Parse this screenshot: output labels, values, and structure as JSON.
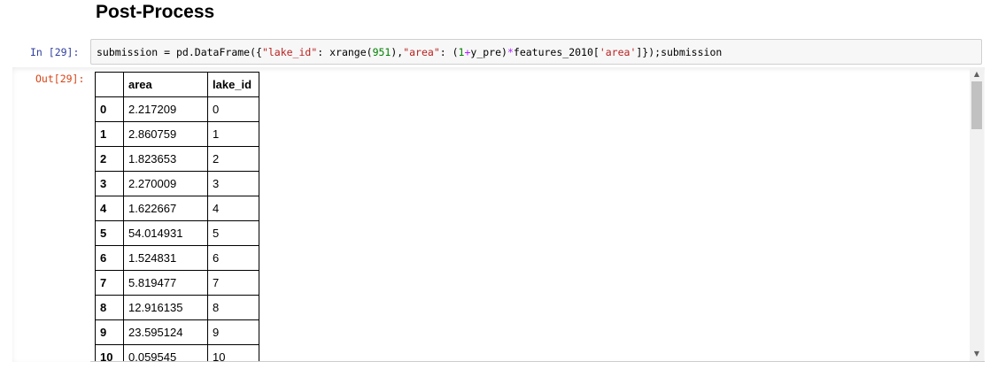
{
  "heading": "Post-Process",
  "input_cell": {
    "prompt": "In  [29]:",
    "code": {
      "p1": "submission = pd.DataFrame({",
      "s1": "\"lake_id\"",
      "p2": ": xrange(",
      "n1": "951",
      "p3": "),",
      "s2": "\"area\"",
      "p4": ": (",
      "n2": "1",
      "o1": "+",
      "p5": "y_pre)",
      "o2": "*",
      "p6": "features_2010[",
      "s3": "'area'",
      "p7": "]});submission"
    }
  },
  "output_cell": {
    "prompt": "Out[29]:",
    "columns": [
      "",
      "area",
      "lake_id"
    ],
    "rows": [
      {
        "index": "0",
        "area": "2.217209",
        "lake_id": "0"
      },
      {
        "index": "1",
        "area": "2.860759",
        "lake_id": "1"
      },
      {
        "index": "2",
        "area": "1.823653",
        "lake_id": "2"
      },
      {
        "index": "3",
        "area": "2.270009",
        "lake_id": "3"
      },
      {
        "index": "4",
        "area": "1.622667",
        "lake_id": "4"
      },
      {
        "index": "5",
        "area": "54.014931",
        "lake_id": "5"
      },
      {
        "index": "6",
        "area": "1.524831",
        "lake_id": "6"
      },
      {
        "index": "7",
        "area": "5.819477",
        "lake_id": "7"
      },
      {
        "index": "8",
        "area": "12.916135",
        "lake_id": "8"
      },
      {
        "index": "9",
        "area": "23.595124",
        "lake_id": "9"
      },
      {
        "index": "10",
        "area": "0.059545",
        "lake_id": "10"
      }
    ]
  },
  "colors": {
    "in_prompt": "#303F9F",
    "out_prompt": "#D84315",
    "string": "#BA2121",
    "number": "#008000",
    "operator": "#AA22FF"
  },
  "icons": {
    "scroll_up": "scroll-up-arrow-icon",
    "scroll_down": "scroll-down-arrow-icon"
  }
}
